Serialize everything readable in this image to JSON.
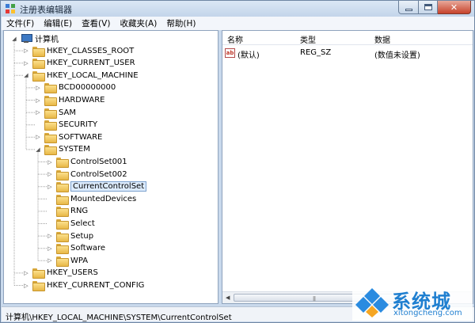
{
  "window": {
    "title": "注册表编辑器"
  },
  "menu": [
    "文件(F)",
    "编辑(E)",
    "查看(V)",
    "收藏夹(A)",
    "帮助(H)"
  ],
  "tree": [
    {
      "label": "计算机",
      "expander": "open",
      "icon": "computer-icon"
    },
    {
      "label": "HKEY_CLASSES_ROOT",
      "expander": "closed"
    },
    {
      "label": "HKEY_CURRENT_USER",
      "expander": "closed"
    },
    {
      "label": "HKEY_LOCAL_MACHINE",
      "expander": "open"
    },
    {
      "label": "BCD00000000",
      "expander": "closed"
    },
    {
      "label": "HARDWARE",
      "expander": "closed"
    },
    {
      "label": "SAM",
      "expander": "closed"
    },
    {
      "label": "SECURITY",
      "expander": "none"
    },
    {
      "label": "SOFTWARE",
      "expander": "closed"
    },
    {
      "label": "SYSTEM",
      "expander": "open"
    },
    {
      "label": "ControlSet001",
      "expander": "closed"
    },
    {
      "label": "ControlSet002",
      "expander": "closed"
    },
    {
      "label": "CurrentControlSet",
      "expander": "closed",
      "selected": true
    },
    {
      "label": "MountedDevices",
      "expander": "none"
    },
    {
      "label": "RNG",
      "expander": "none"
    },
    {
      "label": "Select",
      "expander": "none"
    },
    {
      "label": "Setup",
      "expander": "closed"
    },
    {
      "label": "Software",
      "expander": "closed"
    },
    {
      "label": "WPA",
      "expander": "closed"
    },
    {
      "label": "HKEY_USERS",
      "expander": "closed"
    },
    {
      "label": "HKEY_CURRENT_CONFIG",
      "expander": "closed"
    }
  ],
  "list": {
    "columns": [
      "名称",
      "类型",
      "数据"
    ],
    "rows": [
      {
        "name": "(默认)",
        "type": "REG_SZ",
        "data": "(数值未设置)",
        "icon": "ab"
      }
    ]
  },
  "status": "计算机\\HKEY_LOCAL_MACHINE\\SYSTEM\\CurrentControlSet",
  "watermark": {
    "brand_cn": "系统城",
    "brand_en": "xitongcheng.com"
  }
}
